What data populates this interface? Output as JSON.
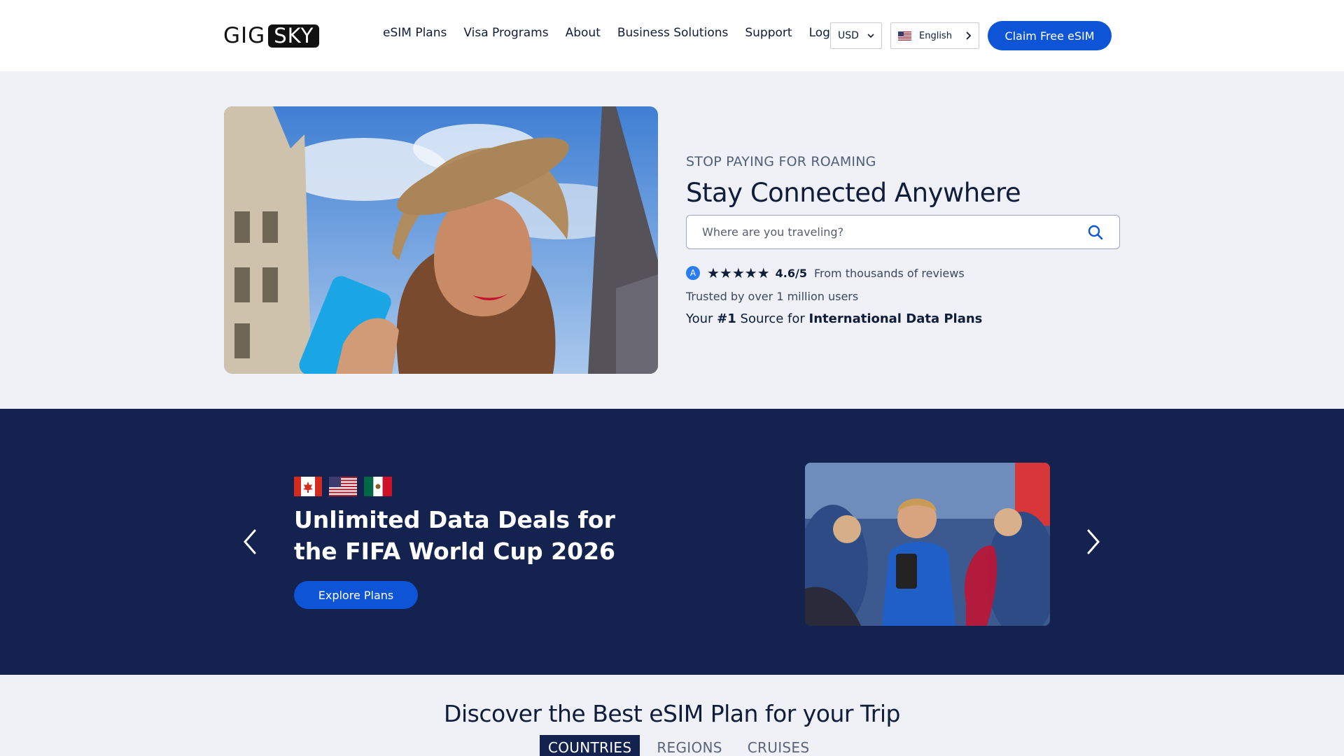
{
  "header": {
    "logo_left": "GIG",
    "logo_right": "SKY",
    "nav": [
      "eSIM Plans",
      "Visa Programs",
      "About",
      "Business Solutions",
      "Support",
      "Login"
    ],
    "currency": "USD",
    "language": "English",
    "cta": "Claim Free eSIM"
  },
  "hero": {
    "eyebrow": "STOP PAYING FOR ROAMING",
    "title": "Stay Connected Anywhere",
    "search_placeholder": "Where are you traveling?",
    "rating_stars": "★★★★★",
    "rating_score": "4.6/5",
    "rating_text": "From thousands of reviews",
    "trusted": "Trusted by over 1 million users",
    "source_pre": "Your",
    "source_rank": "#1",
    "source_mid": "Source for",
    "source_bold": "International Data Plans"
  },
  "promo": {
    "title": "Unlimited Data Deals for the FIFA World Cup 2026",
    "cta": "Explore Plans",
    "flags": [
      "canada-flag",
      "usa-flag",
      "mexico-flag"
    ]
  },
  "discover": {
    "title": "Discover the Best eSIM Plan for your Trip",
    "tabs": [
      "COUNTRIES",
      "REGIONS",
      "CRUISES"
    ]
  },
  "colors": {
    "primary": "#0d54d6",
    "navy": "#13224f",
    "hero_bg": "#eff1f6"
  }
}
